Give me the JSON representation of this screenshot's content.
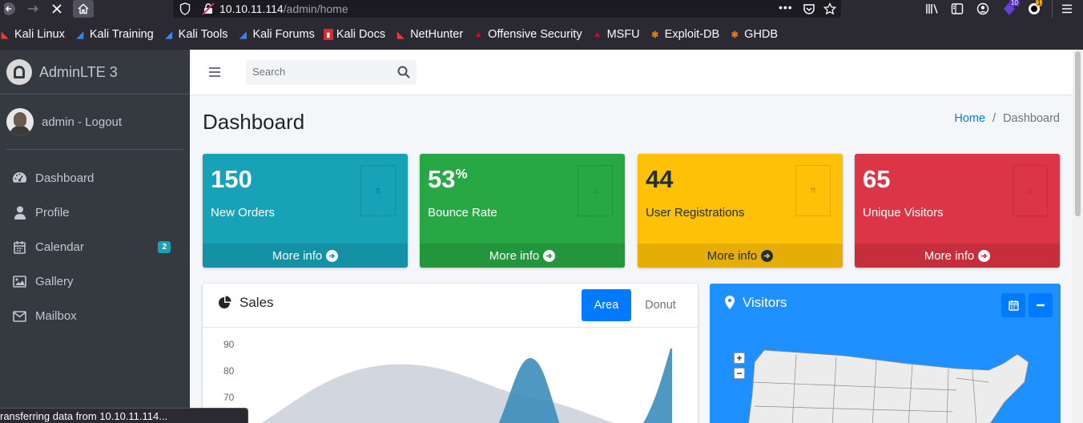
{
  "browser": {
    "url_host": "10.10.11.114",
    "url_path": "/admin/home",
    "menu_dots": "•••",
    "extension_badges": [
      "10",
      "1"
    ],
    "bookmarks": [
      {
        "label": "Kali Linux",
        "icon": "kali-dragon-icon",
        "color": "#e83a3a"
      },
      {
        "label": "Kali Training",
        "icon": "kali-training-icon",
        "color": "#3b82f6"
      },
      {
        "label": "Kali Tools",
        "icon": "kali-tools-icon",
        "color": "#3b82f6"
      },
      {
        "label": "Kali Forums",
        "icon": "kali-forums-icon",
        "color": "#3b82f6"
      },
      {
        "label": "Kali Docs",
        "icon": "kali-docs-icon",
        "color": "#d92c2c"
      },
      {
        "label": "NetHunter",
        "icon": "nethunter-icon",
        "color": "#e83a3a"
      },
      {
        "label": "Offensive Security",
        "icon": "offsec-icon",
        "color": "#c0161c"
      },
      {
        "label": "MSFU",
        "icon": "msfu-icon",
        "color": "#c0161c"
      },
      {
        "label": "Exploit-DB",
        "icon": "exploit-db-icon",
        "color": "#e07b1b"
      },
      {
        "label": "GHDB",
        "icon": "ghdb-icon",
        "color": "#e07b1b"
      }
    ],
    "status_text": "ransferring data from 10.10.11.114..."
  },
  "sidebar": {
    "brand": "AdminLTE 3",
    "user": "admin - Logout",
    "items": [
      {
        "label": "Dashboard",
        "icon": "tachometer-icon"
      },
      {
        "label": "Profile",
        "icon": "user-icon"
      },
      {
        "label": "Calendar",
        "icon": "calendar-icon",
        "badge": "2"
      },
      {
        "label": "Gallery",
        "icon": "image-icon"
      },
      {
        "label": "Mailbox",
        "icon": "envelope-icon"
      }
    ]
  },
  "navbar": {
    "search_placeholder": "Search"
  },
  "page": {
    "title": "Dashboard",
    "breadcrumb": {
      "home": "Home",
      "separator": "/",
      "current": "Dashboard"
    }
  },
  "boxes": [
    {
      "value": "150",
      "suffix": "",
      "label": "New Orders",
      "footer": "More info",
      "color": "#17a2b8"
    },
    {
      "value": "53",
      "suffix": "%",
      "label": "Bounce Rate",
      "footer": "More info",
      "color": "#28a745"
    },
    {
      "value": "44",
      "suffix": "",
      "label": "User Registrations",
      "footer": "More info",
      "color": "#ffc107"
    },
    {
      "value": "65",
      "suffix": "",
      "label": "Unique Visitors",
      "footer": "More info",
      "color": "#dc3545"
    }
  ],
  "sales": {
    "title": "Sales",
    "tabs": [
      "Area",
      "Donut"
    ],
    "active_tab": "Area"
  },
  "chart_data": {
    "type": "area",
    "title": "",
    "y_ticks": [
      90,
      80,
      70
    ],
    "ylim": [
      0,
      100
    ],
    "series": [
      {
        "color": "#d2d6de"
      },
      {
        "color": "#3c8dbc"
      }
    ]
  },
  "visitors": {
    "title": "Visitors",
    "zoom_in": "+",
    "zoom_out": "−"
  }
}
